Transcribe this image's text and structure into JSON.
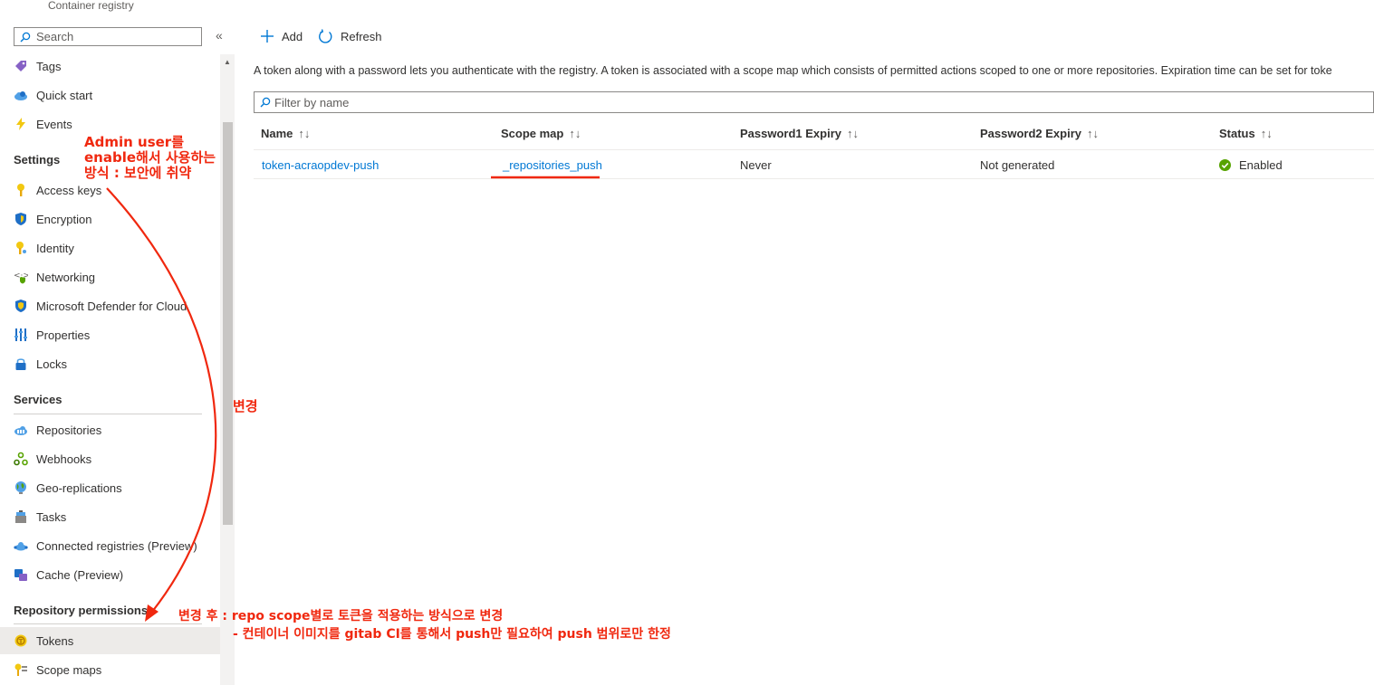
{
  "sidebar": {
    "subtitle": "Container registry",
    "search_placeholder": "Search",
    "items": [
      {
        "label": "Tags"
      },
      {
        "label": "Quick start"
      },
      {
        "label": "Events"
      },
      {
        "label": "Access keys"
      },
      {
        "label": "Encryption"
      },
      {
        "label": "Identity"
      },
      {
        "label": "Networking"
      },
      {
        "label": "Microsoft Defender for Cloud"
      },
      {
        "label": "Properties"
      },
      {
        "label": "Locks"
      },
      {
        "label": "Repositories"
      },
      {
        "label": "Webhooks"
      },
      {
        "label": "Geo-replications"
      },
      {
        "label": "Tasks"
      },
      {
        "label": "Connected registries (Preview)"
      },
      {
        "label": "Cache (Preview)"
      },
      {
        "label": "Tokens"
      },
      {
        "label": "Scope maps"
      }
    ],
    "sections": {
      "settings": "Settings",
      "services": "Services",
      "repository_permissions": "Repository permissions"
    }
  },
  "toolbar": {
    "add_label": "Add",
    "refresh_label": "Refresh"
  },
  "main": {
    "description": "A token along with a password lets you authenticate with the registry. A token is associated with a scope map which consists of permitted actions scoped to one or more repositories. Expiration time can be set for toke",
    "filter_placeholder": "Filter by name",
    "columns": [
      "Name",
      "Scope map",
      "Password1 Expiry",
      "Password2 Expiry",
      "Status"
    ],
    "rows": [
      {
        "name": "token-acraopdev-push",
        "scope_map": "_repositories_push",
        "password1_expiry": "Never",
        "password2_expiry": "Not generated",
        "status": "Enabled"
      }
    ]
  },
  "annotations": {
    "admin_note_line1": "Admin user를",
    "admin_note_line2": "enable해서 사용하는",
    "admin_note_line3": "방식 : 보안에 취약",
    "change_label": "변경",
    "after_line1": "변경 후 : repo scope별로 토큰을 적용하는 방식으로 변경",
    "after_line2": "- 컨테이너 이미지를 gitab CI를 통해서 push만 필요하여 push 범위로만 한정"
  },
  "colors": {
    "accent": "#0078d4",
    "annotation": "#f0280f",
    "success": "#57a300",
    "selected_bg": "#edebe9"
  }
}
